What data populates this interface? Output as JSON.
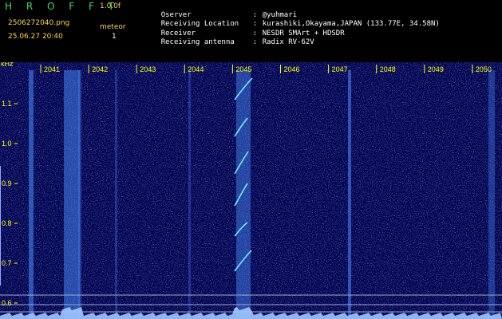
{
  "header": {
    "app_title": "H R O F F T",
    "version": "1.0.0f",
    "filename": "2506272040.png",
    "timestamp": "25.06.27 20:40",
    "mode_label": "meteor",
    "mode_count": "1",
    "info": [
      {
        "label": "Oserver",
        "sep": ":",
        "value": "@yuhmari"
      },
      {
        "label": "Receiving Location",
        "sep": ":",
        "value": "kurashiki,Okayama,JAPAN (133.77E, 34.58N)"
      },
      {
        "label": "Receiver",
        "sep": ":",
        "value": "NESDR SMArt + HDSDR"
      },
      {
        "label": "Receiving antenna",
        "sep": ":",
        "value": "Radix RV-62V"
      }
    ]
  },
  "spectrogram": {
    "y_unit": "kHz",
    "y_ticks": [
      "1.1",
      "1.0",
      "0.9",
      "0.8",
      "0.7",
      "0.6"
    ],
    "time_ticks": [
      "2041",
      "2042",
      "2043",
      "2044",
      "2045",
      "2046",
      "2047",
      "2048",
      "2049",
      "2050"
    ],
    "colors": {
      "background": "#00004a",
      "label": "#ffff00",
      "trace": "#6ff0ff",
      "noise_band": "#4a8cff",
      "baseline": "#9ec6ff"
    }
  }
}
